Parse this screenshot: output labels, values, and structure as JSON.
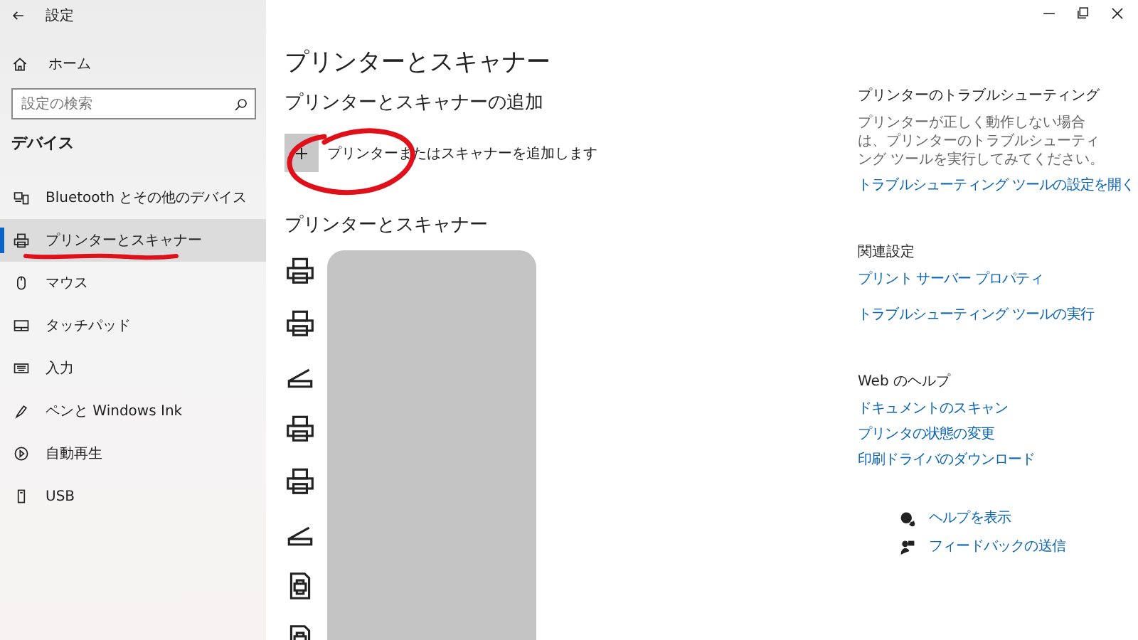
{
  "window": {
    "title": "設定"
  },
  "sidebar": {
    "home": "ホーム",
    "search": {
      "placeholder": "設定の検索"
    },
    "section": "デバイス",
    "items": [
      {
        "label": "Bluetooth とその他のデバイス",
        "kind": "bluetooth",
        "selected": false
      },
      {
        "label": "プリンターとスキャナー",
        "kind": "printer",
        "selected": true
      },
      {
        "label": "マウス",
        "kind": "mouse",
        "selected": false
      },
      {
        "label": "タッチパッド",
        "kind": "touchpad",
        "selected": false
      },
      {
        "label": "入力",
        "kind": "keyboard",
        "selected": false
      },
      {
        "label": "ペンと Windows Ink",
        "kind": "pen",
        "selected": false
      },
      {
        "label": "自動再生",
        "kind": "autoplay",
        "selected": false
      },
      {
        "label": "USB",
        "kind": "usb",
        "selected": false
      }
    ]
  },
  "main": {
    "title": "プリンターとスキャナー",
    "add_heading": "プリンターとスキャナーの追加",
    "add_button": "プリンターまたはスキャナーを追加します",
    "list_heading": "プリンターとスキャナー",
    "names_redacted": true,
    "devices": [
      {
        "kind": "printer"
      },
      {
        "kind": "printer"
      },
      {
        "kind": "scanner"
      },
      {
        "kind": "printer"
      },
      {
        "kind": "printer"
      },
      {
        "kind": "scanner"
      },
      {
        "kind": "fax"
      },
      {
        "kind": "fax"
      }
    ]
  },
  "help": {
    "sections": [
      {
        "heading": "プリンターのトラブルシューティング",
        "text": "プリンターが正しく動作しない場合は、プリンターのトラブルシューティング ツールを実行してみてください。",
        "links": [
          "トラブルシューティング ツールの設定を開く"
        ]
      },
      {
        "heading": "関連設定",
        "links": [
          "プリント サーバー プロパティ",
          "トラブルシューティング ツールの実行"
        ]
      },
      {
        "heading": "Web のヘルプ",
        "links": [
          "ドキュメントのスキャン",
          "プリンタの状態の変更",
          "印刷ドライバのダウンロード"
        ]
      }
    ],
    "actions": [
      {
        "kind": "help",
        "label": "ヘルプを表示"
      },
      {
        "kind": "feedback",
        "label": "フィードバックの送信"
      }
    ]
  },
  "annotations": [
    {
      "kind": "circle"
    },
    {
      "kind": "underline"
    }
  ]
}
